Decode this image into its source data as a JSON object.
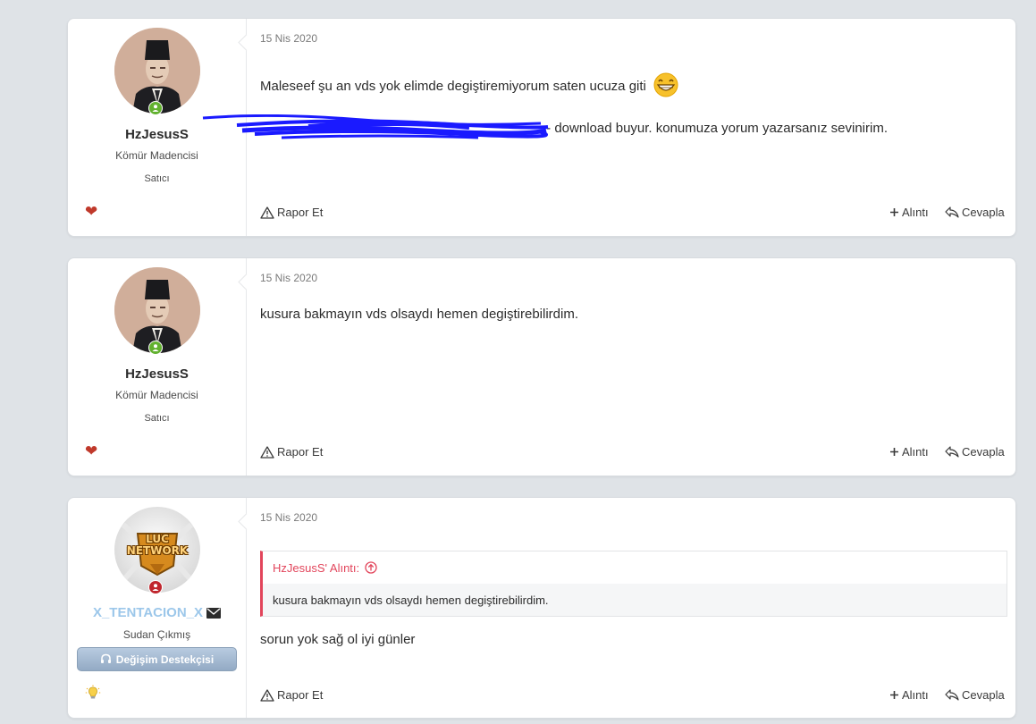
{
  "posts": [
    {
      "username": "HzJesusS",
      "user_title": "Kömür Madencisi",
      "user_banner": "Satıcı",
      "date": "15 Nis 2020",
      "message_line1": "Maleseef şu an vds yok elimde degiştiremiyorum saten ucuza giti",
      "message_line2_visible": "- download buyur. konumuza yorum yazarsanız sevinirim.",
      "report_label": "Rapor Et",
      "quote_label": "Alıntı",
      "reply_label": "Cevapla",
      "reaction_icon": "heart-icon",
      "status_color": "#62b12f"
    },
    {
      "username": "HzJesusS",
      "user_title": "Kömür Madencisi",
      "user_banner": "Satıcı",
      "date": "15 Nis 2020",
      "message": "kusura bakmayın vds olsaydı hemen degiştirebilirdim.",
      "report_label": "Rapor Et",
      "quote_label": "Alıntı",
      "reply_label": "Cevapla",
      "reaction_icon": "heart-icon",
      "status_color": "#62b12f"
    },
    {
      "username": "X_TENTACION_X",
      "user_title": "Sudan Çıkmış",
      "badge_label": "Değişim Destekçisi",
      "date": "15 Nis 2020",
      "quote_author": "HzJesusS' Alıntı:",
      "quote_text": "kusura bakmayın vds olsaydı hemen degiştirebilirdim.",
      "message": "sorun yok sağ ol iyi günler",
      "report_label": "Rapor Et",
      "quote_label": "Alıntı",
      "reply_label": "Cevapla",
      "reaction_icon": "lightbulb-icon",
      "status_color": "#c0262d",
      "username_color": "#9cc7ea",
      "avatar_text": "LUC NETWORK"
    }
  ]
}
